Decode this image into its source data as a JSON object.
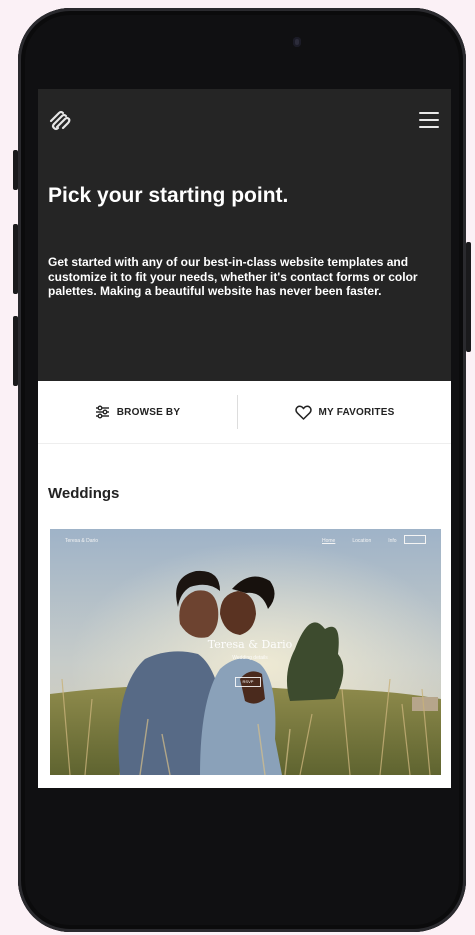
{
  "hero": {
    "title": "Pick your starting point.",
    "description": "Get started with any of our best-in-class website templates and customize it to fit your needs, whether it's contact forms or color palettes. Making a beautiful website has never been faster."
  },
  "filters": {
    "browse_label": "BROWSE BY",
    "favorites_label": "MY FAVORITES"
  },
  "section": {
    "title": "Weddings"
  },
  "template_card": {
    "brand": "Teresa & Dario",
    "nav_links": [
      "Home",
      "Location",
      "Info"
    ],
    "heading": "Teresa & Dario",
    "details": "Wedding details",
    "button": "RSVP"
  },
  "colors": {
    "hero_background": "#252525",
    "page_background": "#fbf1f6",
    "phone_body": "#101012"
  }
}
